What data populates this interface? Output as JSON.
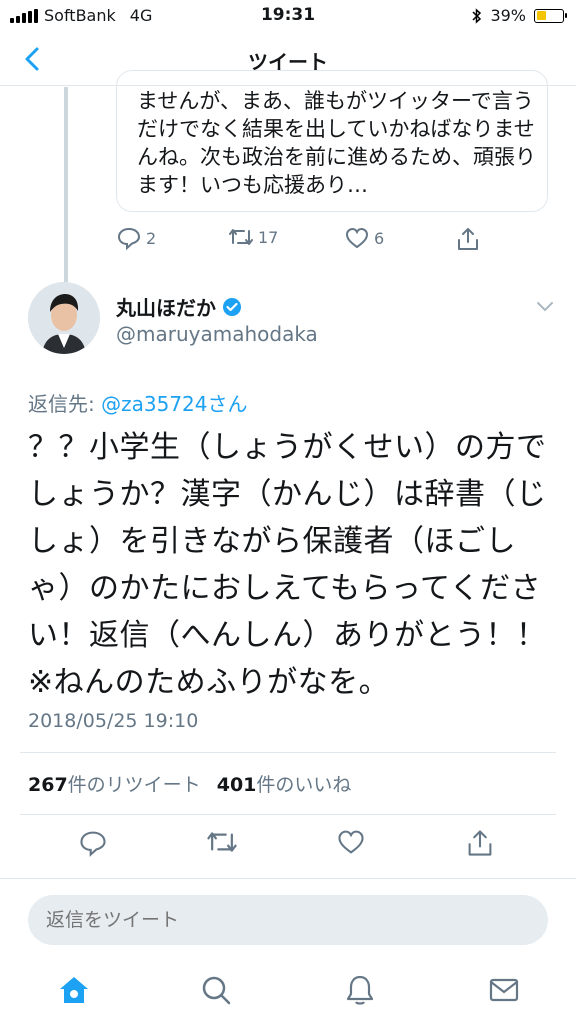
{
  "status_bar": {
    "carrier": "SoftBank",
    "network": "4G",
    "time": "19:31",
    "battery": "39%"
  },
  "nav": {
    "title": "ツイート"
  },
  "quoted": {
    "text": "ませんが、まあ、誰もがツイッターで言うだけでなく結果を出していかねばなりませんね。次も政治を前に進めるため、頑張ります！いつも応援あり…",
    "reply_count": "2",
    "retweet_count": "17",
    "like_count": "6"
  },
  "tweet": {
    "display_name": "丸山ほだか",
    "handle": "@maruyamahodaka",
    "reply_to_label": "返信先: ",
    "reply_to_mention": "@za35724さん",
    "text": "？？小学生（しょうがくせい）の方でしょうか？漢字（かんじ）は辞書（じしょ）を引きながら保護者（ほごしゃ）のかたにおしえてもらってください！返信（へんしん）ありがとう！！※ねんのためふりがなを。",
    "date": "2018/05/25 19:10",
    "retweets": "267",
    "retweets_label": "件のリツイート",
    "likes": "401",
    "likes_label": "件のいいね"
  },
  "reply": {
    "placeholder": "返信をツイート"
  },
  "colors": {
    "accent": "#1da1f2",
    "muted": "#657786",
    "border": "#e1e8ed"
  }
}
